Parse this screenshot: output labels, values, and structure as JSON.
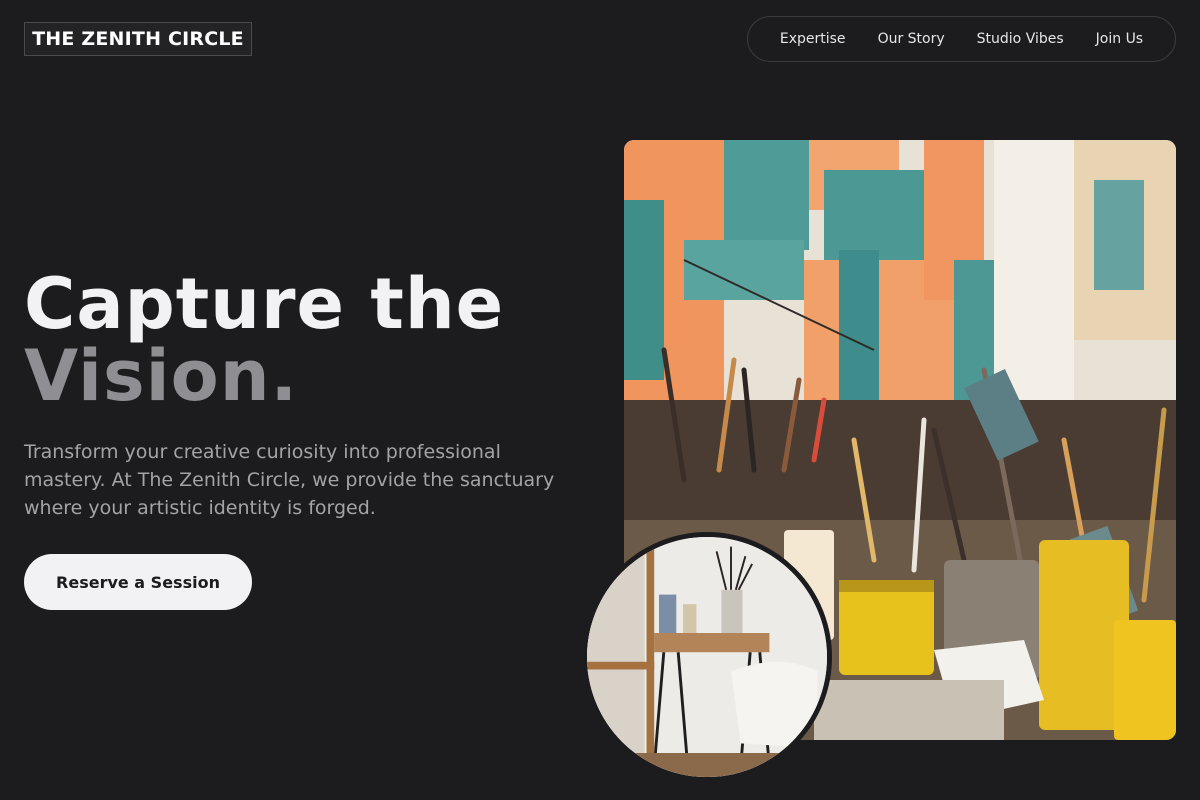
{
  "brand": {
    "name": "THE ZENITH CIRCLE"
  },
  "nav": {
    "items": [
      {
        "label": "Expertise"
      },
      {
        "label": "Our Story"
      },
      {
        "label": "Studio Vibes"
      },
      {
        "label": "Join Us"
      }
    ]
  },
  "hero": {
    "headline_line1": "Capture the",
    "headline_line2": "Vision.",
    "description": "Transform your creative curiosity into professional mastery. At The Zenith Circle, we provide the sanctuary where your artistic identity is forged.",
    "cta_label": "Reserve a Session"
  },
  "colors": {
    "background": "#1c1c1e",
    "text_primary": "#f2f2f5",
    "text_muted": "#8e8e93",
    "button_bg": "#f2f2f5"
  }
}
